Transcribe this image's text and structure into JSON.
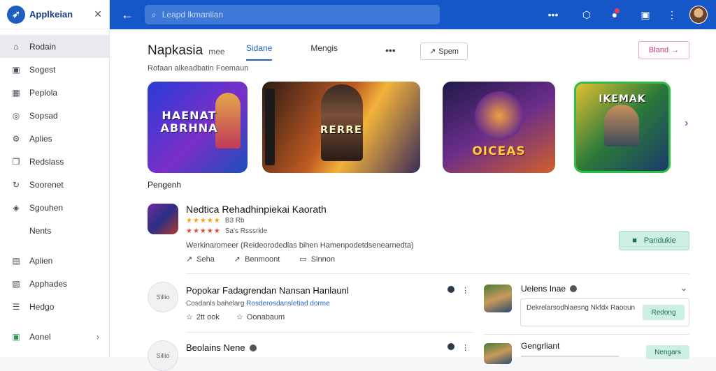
{
  "sidebar": {
    "title": "Applkeian",
    "logo_icon": "app-logo-icon",
    "items": [
      {
        "label": "Rodain",
        "icon": "home-icon"
      },
      {
        "label": "Sogest",
        "icon": "bookmark-icon"
      },
      {
        "label": "Peplola",
        "icon": "grid-icon"
      },
      {
        "label": "Sopsad",
        "icon": "compass-icon"
      },
      {
        "label": "Aplies",
        "icon": "gear-icon"
      },
      {
        "label": "Redslass",
        "icon": "copy-icon"
      },
      {
        "label": "Soorenet",
        "icon": "refresh-icon"
      },
      {
        "label": "Sgouhen",
        "icon": "tag-icon"
      },
      {
        "label": "Nents",
        "icon": ""
      },
      {
        "label": "Aplien",
        "icon": "chart-icon"
      },
      {
        "label": "Apphades",
        "icon": "image-icon"
      },
      {
        "label": "Hedgo",
        "icon": "list-icon"
      },
      {
        "label": "Aonel",
        "icon": "shop-icon"
      }
    ]
  },
  "topbar": {
    "search_placeholder": "Leapd lkmanlian"
  },
  "main": {
    "title": "Napkasia",
    "title_sub": "mee",
    "tabs": [
      {
        "label": "Sidane"
      },
      {
        "label": "Mengis"
      }
    ],
    "sort_label": "Spem",
    "brand_label": "Bland",
    "subtitle": "Rofaan alkeadbatin Foemaun",
    "banners": [
      {
        "text": "HAENAT ABRHNA"
      },
      {
        "text": "RERRE"
      },
      {
        "text": "OICEAS"
      },
      {
        "text": "IKEMAK"
      }
    ],
    "section_title": "Pengenh",
    "featured": {
      "title": "Nedtica Rehadhinpiekai Kaorath",
      "rating1": "B3 Rb",
      "rating2": "Sa's Rsssrkle",
      "desc": "Werkinaromeer (Reideorodedlas bihen Hamenpodetdsenearnedta)",
      "actions": [
        {
          "label": "Seha"
        },
        {
          "label": "Benmoont"
        },
        {
          "label": "Sinnon"
        }
      ],
      "button": "Pandukie"
    },
    "list": [
      {
        "title": "Popokar Fadagrendan Nansan Hanlaunl",
        "icon_text": "Sillio",
        "sub_plain": "Cosdanls bahelarg",
        "sub_link": "Rosderosdansletiad dorme",
        "meta1": "2tt ook",
        "meta2": "Oonabaum"
      },
      {
        "title": "Beolains Nene",
        "icon_text": "Sillio"
      }
    ],
    "panel": {
      "title": "Uelens Inae",
      "box_text": "Dekrelarsodhlaesng Nkfdx Raooun",
      "box_button": "Redong",
      "second_title": "Gengrliant",
      "second_button": "Nengars"
    }
  }
}
